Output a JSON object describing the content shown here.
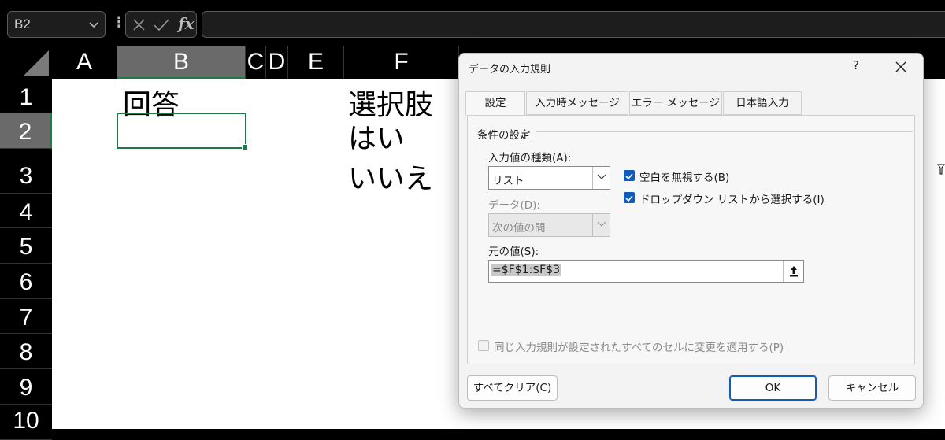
{
  "formula_bar": {
    "name_box": "B2",
    "cancel_icon": "x-icon",
    "enter_icon": "check-icon",
    "fx_label": "fx",
    "formula": ""
  },
  "sheet": {
    "columns": [
      "A",
      "B",
      "C",
      "D",
      "E",
      "F"
    ],
    "selected_column": "B",
    "rows": [
      "1",
      "2",
      "3",
      "4",
      "5",
      "6",
      "7",
      "8",
      "9",
      "10"
    ],
    "selected_row": "2",
    "cells": {
      "B1": "回答",
      "F1": "選択肢",
      "F2": "はい",
      "F3": "いいえ"
    }
  },
  "dialog": {
    "title": "データの入力規則",
    "help": "?",
    "tabs": [
      "設定",
      "入力時メッセージ",
      "エラー メッセージ",
      "日本語入力"
    ],
    "active_tab": "設定",
    "section_title": "条件の設定",
    "type_label": "入力値の種類(A):",
    "type_value": "リスト",
    "ignore_blank_label": "空白を無視する(B)",
    "ignore_blank_checked": true,
    "dropdown_label": "ドロップダウン リストから選択する(I)",
    "dropdown_checked": true,
    "data_label": "データ(D):",
    "data_value": "次の値の間",
    "source_label": "元の値(S):",
    "source_value": "=$F$1:$F$3",
    "apply_all_label": "同じ入力規則が設定されたすべてのセルに変更を適用する(P)",
    "apply_all_checked": false,
    "clear_all_button": "すべてクリア(C)",
    "ok_button": "OK",
    "cancel_button": "キャンセル"
  }
}
